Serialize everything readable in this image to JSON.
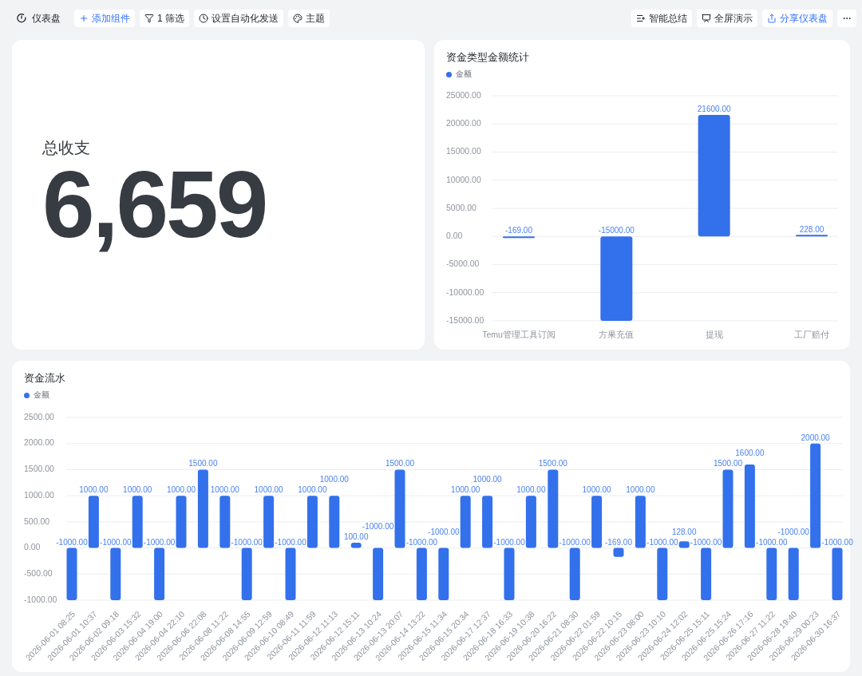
{
  "toolbar": {
    "title": "仪表盘",
    "left_buttons": [
      {
        "kind": "add",
        "label": "添加组件",
        "primary": true
      },
      {
        "kind": "filter",
        "label": "1 筛选",
        "primary": false
      },
      {
        "kind": "schedule",
        "label": "设置自动化发送",
        "primary": false
      },
      {
        "kind": "theme",
        "label": "主题",
        "primary": false
      }
    ],
    "right_buttons": [
      {
        "kind": "summary",
        "label": "智能总结",
        "primary": false
      },
      {
        "kind": "present",
        "label": "全屏演示",
        "primary": false
      },
      {
        "kind": "share",
        "label": "分享仪表盘",
        "primary": true
      },
      {
        "kind": "more",
        "primary": false
      }
    ]
  },
  "kpi_card": {
    "label": "总收支",
    "value": "6,659"
  },
  "type_chart": {
    "chart_data": {
      "type": "bar",
      "title": "资金类型金额统计",
      "categories": [
        "Temu管理工具订阅",
        "方果充值",
        "提现",
        "工厂赔付"
      ],
      "series": [
        {
          "name": "金额",
          "color": "#3370eb",
          "values": [
            -169,
            -15000,
            21600,
            228
          ]
        }
      ],
      "ylim": [
        -15000,
        25000
      ],
      "yticks": [
        {
          "value": 25000,
          "label": "25000.00"
        },
        {
          "value": 20000,
          "label": "20000.00"
        },
        {
          "value": 15000,
          "label": "15000.00"
        },
        {
          "value": 10000,
          "label": "10000.00"
        },
        {
          "value": 5000,
          "label": "5000.00"
        },
        {
          "value": 0,
          "label": "0.00"
        },
        {
          "value": -5000,
          "label": "-5000.00"
        },
        {
          "value": -10000,
          "label": "-10000.00"
        },
        {
          "value": -15000,
          "label": "-15000.00"
        }
      ],
      "grid": true,
      "value_labels": [
        "-169.00",
        "-15000.00",
        "21600.00",
        "228.00"
      ]
    }
  },
  "flow_chart": {
    "chart_data": {
      "type": "bar",
      "title": "资金流水",
      "categories": [
        "2026-06-01 08:25",
        "2026-06-01 10:37",
        "2026-06-02 09:18",
        "2026-06-03 15:32",
        "2026-06-04 19:00",
        "2026-06-04 22:10",
        "2026-06-06 22:08",
        "2026-06-08 11:22",
        "2026-06-08 14:55",
        "2026-06-09 12:59",
        "2026-06-10 08:49",
        "2026-06-11 11:59",
        "2026-06-12 11:13",
        "2026-06-12 15:11",
        "2026-06-13 10:24",
        "2026-06-13 20:07",
        "2026-06-14 13:22",
        "2026-06-15 11:34",
        "2026-06-15 20:34",
        "2026-06-17 12:37",
        "2026-06-18 16:33",
        "2026-06-19 10:38",
        "2026-06-20 16:22",
        "2026-06-21 08:30",
        "2026-06-22 01:59",
        "2026-06-22 10:15",
        "2026-06-23 08:00",
        "2026-06-23 10:10",
        "2026-06-24 12:02",
        "2026-06-25 15:11",
        "2026-06-25 15:24",
        "2026-06-26 17:16",
        "2026-06-27 11:22",
        "2026-06-28 19:40",
        "2026-06-29 00:23",
        "2026-06-30 16:37"
      ],
      "series": [
        {
          "name": "金额",
          "color": "#3370eb",
          "values": [
            -1000,
            1000,
            -1000,
            1000,
            -1000,
            1000,
            1500,
            1000,
            -1000,
            1000,
            -1000,
            1000,
            1000,
            100,
            -1000,
            1500,
            -1000,
            -1000,
            1000,
            1000,
            -1000,
            1000,
            1500,
            -1000,
            1000,
            -169,
            1000,
            -1000,
            128,
            -1000,
            1500,
            1600,
            -1000,
            -1000,
            2000,
            -1000
          ]
        }
      ],
      "ylim": [
        -1000,
        2500
      ],
      "yticks": [
        {
          "value": 2500,
          "label": "2500.00"
        },
        {
          "value": 2000,
          "label": "2000.00"
        },
        {
          "value": 1500,
          "label": "1500.00"
        },
        {
          "value": 1000,
          "label": "1000.00"
        },
        {
          "value": 500,
          "label": "500.00"
        },
        {
          "value": 0,
          "label": "0.00"
        },
        {
          "value": -500,
          "label": "-500.00"
        },
        {
          "value": -1000,
          "label": "-1000.00"
        }
      ],
      "grid": true,
      "value_labels": [
        "-1000.00",
        "1000.00",
        "-1000.00",
        "1000.00",
        "-1000.00",
        "1000.00",
        "1500.00",
        "1000.00",
        "-1000.00",
        "1000.00",
        "-1000.00",
        "1000.00",
        "1000.00",
        "100.00",
        "-1000.00",
        "1500.00",
        "-1000.00",
        "-1000.00",
        "1000.00",
        "1000.00",
        "-1000.00",
        "1000.00",
        "1500.00",
        "-1000.00",
        "1000.00",
        "-169.00",
        "1000.00",
        "-1000.00",
        "128.00",
        "-1000.00",
        "1500.00",
        "1600.00",
        "-1000.00",
        "-1000.00",
        "2000.00",
        "-1000.00"
      ]
    }
  }
}
